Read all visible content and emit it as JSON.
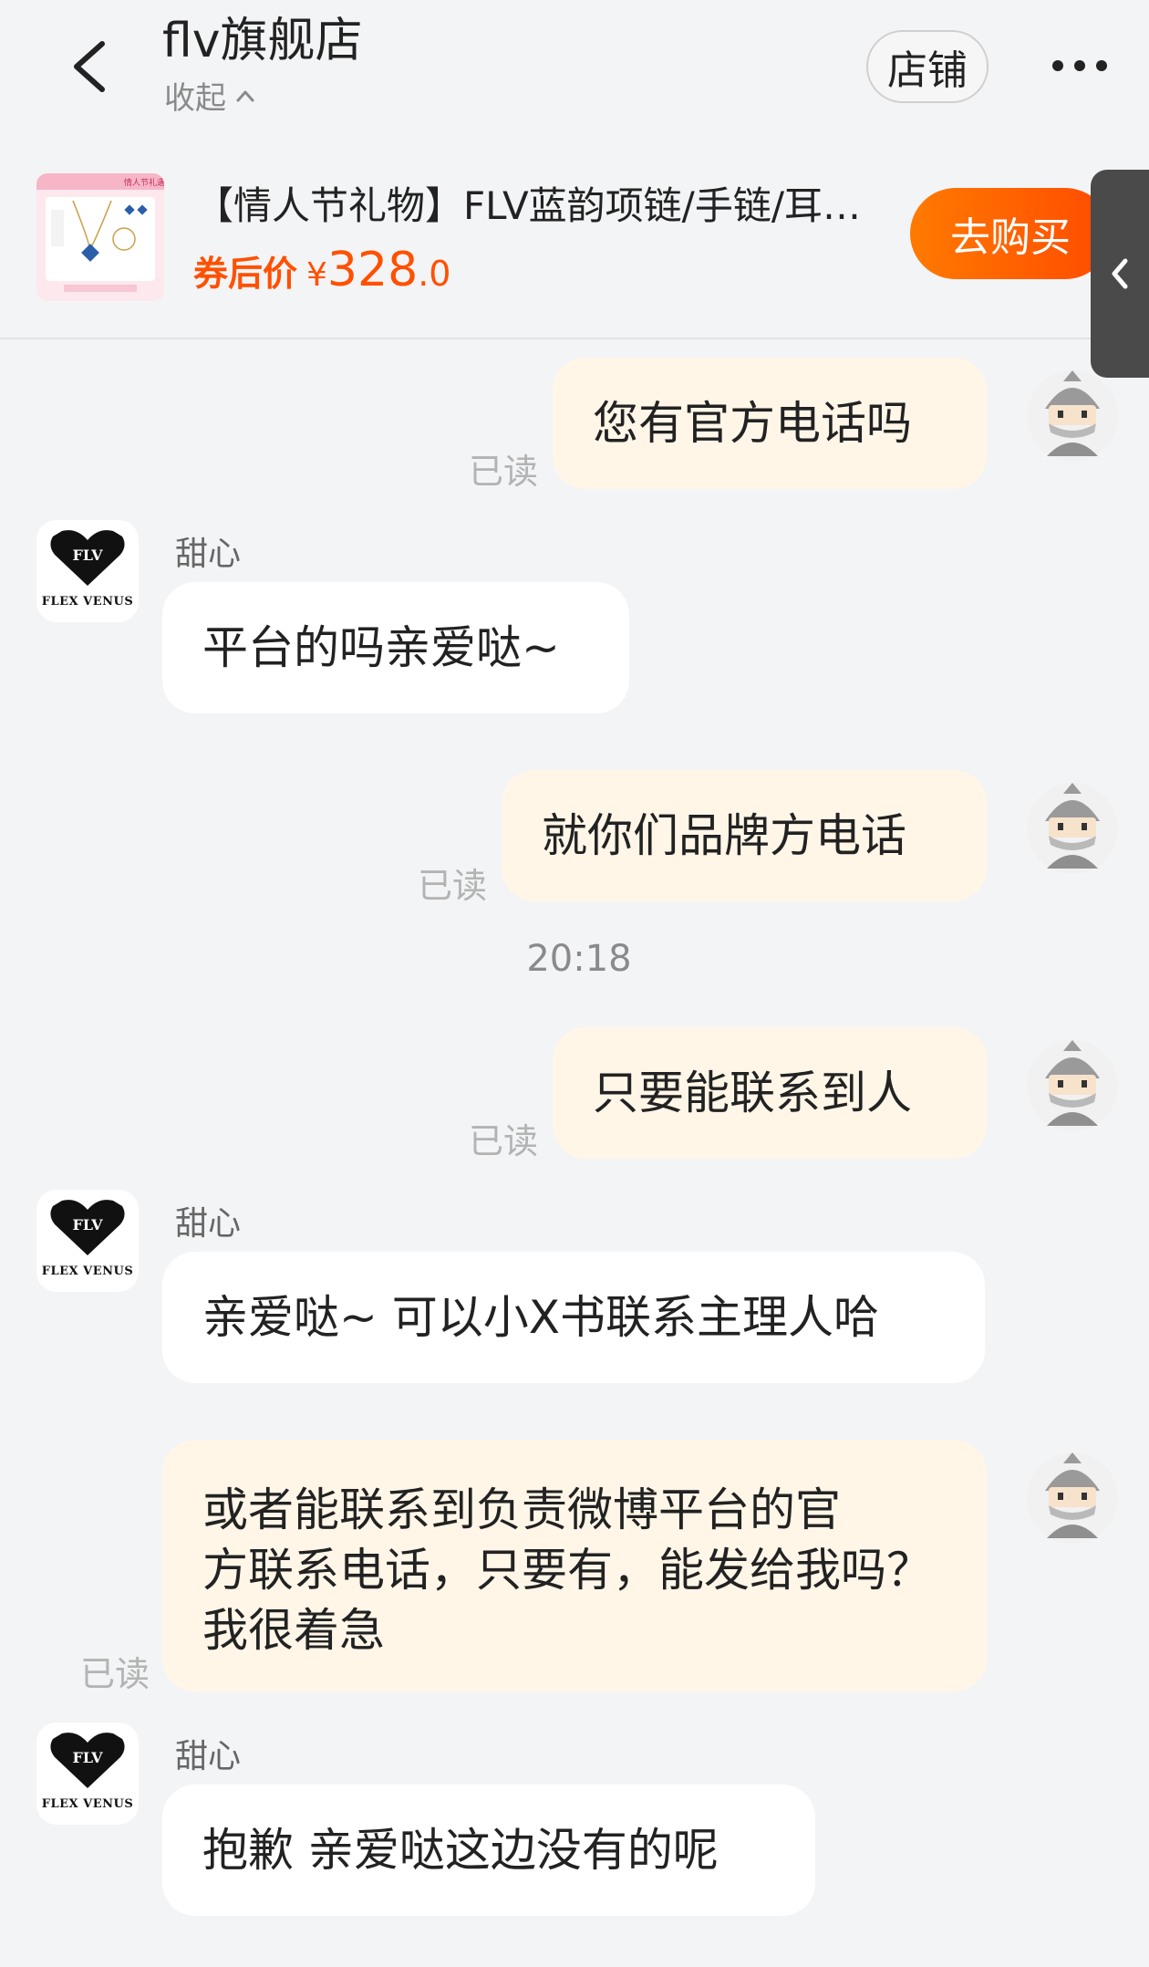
{
  "header": {
    "shop_name": "flv旗舰店",
    "collapse_label": "收起",
    "store_button": "店铺"
  },
  "product": {
    "title": "【情人节礼物】FLV蓝韵项链/手链/耳…",
    "price_label": "券后价",
    "currency": "¥",
    "price_int": "328",
    "price_dec": ".0",
    "buy_button": "去购买",
    "thumb_banner": "情人节礼遇"
  },
  "chat": {
    "read_label": "已读",
    "shop_brand": "FLEX VENUS",
    "shop_logo_text": "FLV",
    "sender_name": "甜心",
    "time_separator": "20:18",
    "messages": [
      {
        "from": "me",
        "text": "您有官方电话吗"
      },
      {
        "from": "shop",
        "text": "平台的吗亲爱哒~"
      },
      {
        "from": "me",
        "text": "就你们品牌方电话"
      },
      {
        "from": "me",
        "text": "只要能联系到人"
      },
      {
        "from": "shop",
        "text": "亲爱哒~ 可以小X书联系主理人哈"
      },
      {
        "from": "me",
        "lines": [
          "或者能联系到负责微博平台的官",
          "方联系电话，只要有，能发给我吗？",
          "我很着急"
        ]
      },
      {
        "from": "shop",
        "text": "抱歉 亲爱哒这边没有的呢"
      }
    ]
  },
  "colors": {
    "accent": "#ff5000",
    "my_bubble": "#fff6e8",
    "their_bubble": "#ffffff",
    "background": "#f3f4f6"
  },
  "icons": [
    "back-arrow-icon",
    "chevron-up-icon",
    "more-icon",
    "chevron-left-icon"
  ]
}
